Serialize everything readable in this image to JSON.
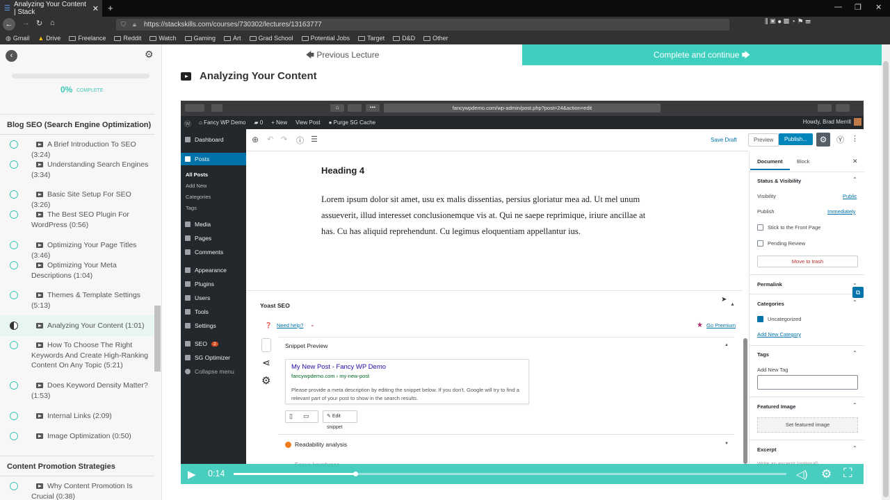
{
  "browser": {
    "tab_title": "Analyzing Your Content | Stack",
    "url": "https://stackskills.com/courses/730302/lectures/13163777",
    "bookmarks": [
      "Gmail",
      "Drive",
      "Freelance",
      "Reddit",
      "Watch",
      "Gaming",
      "Art",
      "Grad School",
      "Potential Jobs",
      "Target",
      "D&D",
      "Other"
    ]
  },
  "sidebar": {
    "progress_percent": "0%",
    "progress_label": "COMPLETE",
    "progress_value": 0,
    "section1": "Blog SEO (Search Engine Optimization)",
    "lectures": [
      "A Brief Introduction To SEO (3:24)",
      "Understanding Search Engines (3:34)",
      "Basic Site Setup For SEO (3:26)",
      "The Best SEO Plugin For WordPress (0:56)",
      "Optimizing Your Page Titles (3:46)",
      "Optimizing Your Meta Descriptions (1:04)",
      "Themes & Template Settings (5:13)",
      "Analyzing Your Content (1:01)",
      "How To Choose The Right Keywords And Create High-Ranking Content On Any Topic (5:21)",
      "Does Keyword Density Matter? (1:53)",
      "Internal Links (2:09)",
      "Image Optimization (0:50)"
    ],
    "section2": "Content Promotion Strategies",
    "lecture_next_section": "Why Content Promotion Is Crucial (0:38)"
  },
  "nav": {
    "previous": "Previous Lecture",
    "next": "Complete and continue"
  },
  "lecture_title": "Analyzing Your Content",
  "video": {
    "inner_url": "fancywpdemo.com/wp-admin/post.php?post=24&action=edit",
    "admin_bar": [
      "Fancy WP Demo",
      "0",
      "New",
      "View Post",
      "Purge SG Cache"
    ],
    "howdy": "Howdy, Brad Merrill",
    "menu": [
      "Dashboard",
      "Posts",
      "Media",
      "Pages",
      "Comments",
      "Appearance",
      "Plugins",
      "Users",
      "Tools",
      "Settings",
      "SEO",
      "SG Optimizer",
      "Collapse menu"
    ],
    "posts_sub": [
      "All Posts",
      "Add New",
      "Categories",
      "Tags"
    ],
    "seo_badge": "2",
    "save_draft": "Save Draft",
    "preview": "Preview",
    "publish": "Publish...",
    "heading": "Heading 4",
    "paragraph": "Lorem ipsum dolor sit amet, usu ex malis dissentias, persius gloriatur mea ad. Ut mel unum assueverit, illud interesset conclusionemque vis at. Qui ne saepe reprimique, iriure ancillae at has. Cu has aliquid reprehendunt. Cu legimus eloquentiam appellantur ius.",
    "yoast_title": "Yoast SEO",
    "need_help": "Need help?",
    "go_premium": "Go Premium",
    "snippet_preview": "Snippet Preview",
    "snippet_title": "My New Post - Fancy WP Demo",
    "snippet_url": "fancywpdemo.com › my-new-post",
    "snippet_desc": "Please provide a meta description by editing the snippet below. If you don't, Google will try to find a relevant part of your post to show in the search results.",
    "edit_snippet": "Edit snippet",
    "readability": "Readability analysis",
    "focus": "Focus keyphrase",
    "panel": {
      "tab_document": "Document",
      "tab_block": "Block",
      "status_visibility": "Status & Visibility",
      "visibility": "Visibility",
      "visibility_val": "Public",
      "publish": "Publish",
      "publish_val": "Immediately",
      "stick": "Stick to the Front Page",
      "pending": "Pending Review",
      "trash": "Move to trash",
      "permalink": "Permalink",
      "categories": "Categories",
      "uncategorized": "Uncategorized",
      "add_category": "Add New Category",
      "tags": "Tags",
      "add_tag": "Add New Tag",
      "featured": "Featured Image",
      "set_featured": "Set featured image",
      "excerpt": "Excerpt",
      "excerpt_placeholder": "Write an excerpt (optional)"
    },
    "time": "0:14",
    "playback_fraction": 0.22
  }
}
